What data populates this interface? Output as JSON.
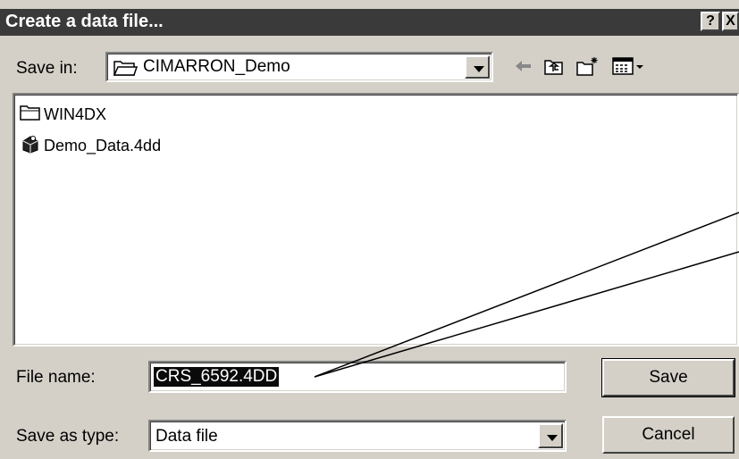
{
  "title": "Create a data file...",
  "title_buttons": {
    "help": "?",
    "close": "X"
  },
  "save_in": {
    "label": "Save in:",
    "value": "CIMARRON_Demo"
  },
  "file_list": [
    {
      "name": "WIN4DX",
      "icon": "folder-icon"
    },
    {
      "name": "Demo_Data.4dd",
      "icon": "data-file-icon"
    }
  ],
  "file_name": {
    "label": "File name:",
    "value": "CRS_6592.4DD"
  },
  "save_as_type": {
    "label": "Save as type:",
    "value": "Data file"
  },
  "buttons": {
    "save": "Save",
    "cancel": "Cancel"
  },
  "toolbar_icons": [
    "back-arrow-icon",
    "up-folder-icon",
    "new-folder-icon",
    "view-menu-icon"
  ],
  "colors": {
    "titlebar": "#3a3a3a",
    "face": "#d4d0c8",
    "selection": "#0a0a0a"
  }
}
